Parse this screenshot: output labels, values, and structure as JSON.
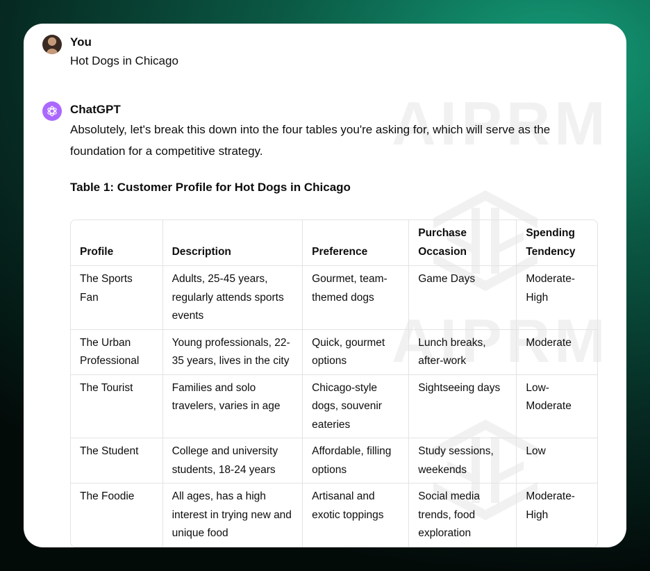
{
  "user": {
    "name": "You",
    "message": "Hot Dogs in Chicago"
  },
  "assistant": {
    "name": "ChatGPT",
    "intro": "Absolutely, let's break this down into the four tables you're asking for, which will serve as the foundation for a competitive strategy.",
    "table_title": "Table 1: Customer Profile for Hot Dogs in Chicago"
  },
  "watermark": "AIPRM",
  "table": {
    "headers": [
      "Profile",
      "Description",
      "Preference",
      "Purchase Occasion",
      "Spending Tendency"
    ],
    "rows": [
      [
        "The Sports Fan",
        "Adults, 25-45 years, regularly attends sports events",
        "Gourmet, team-themed dogs",
        "Game Days",
        "Moderate-High"
      ],
      [
        "The Urban Professional",
        "Young professionals, 22-35 years, lives in the city",
        "Quick, gourmet options",
        "Lunch breaks, after-work",
        "Moderate"
      ],
      [
        "The Tourist",
        "Families and solo travelers, varies in age",
        "Chicago-style dogs, souvenir eateries",
        "Sightseeing days",
        "Low-Moderate"
      ],
      [
        "The Student",
        "College and university students, 18-24 years",
        "Affordable, filling options",
        "Study sessions, weekends",
        "Low"
      ],
      [
        "The Foodie",
        "All ages, has a high interest in trying new and unique food",
        "Artisanal and exotic toppings",
        "Social media trends, food exploration",
        "Moderate-High"
      ]
    ]
  },
  "colors": {
    "gpt_avatar": "#ab68ff",
    "bg_gradient_accent": "#149c78"
  }
}
